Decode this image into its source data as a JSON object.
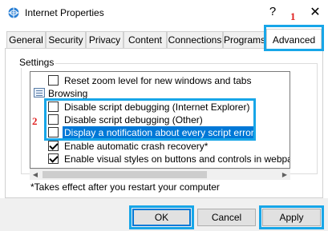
{
  "window": {
    "title": "Internet Properties",
    "help_glyph": "?",
    "close_glyph": "✕"
  },
  "annotations": [
    "1",
    "2"
  ],
  "tabs": [
    {
      "label": "General"
    },
    {
      "label": "Security"
    },
    {
      "label": "Privacy"
    },
    {
      "label": "Content"
    },
    {
      "label": "Connections"
    },
    {
      "label": "Programs"
    },
    {
      "label": "Advanced",
      "active": true
    }
  ],
  "settings": {
    "group_label": "Settings",
    "items": [
      {
        "type": "checkbox",
        "checked": false,
        "label": "Reset zoom level for new windows and tabs"
      },
      {
        "type": "category",
        "label": "Browsing",
        "icon": "folder-icon"
      },
      {
        "type": "checkbox",
        "checked": false,
        "label": "Disable script debugging (Internet Explorer)"
      },
      {
        "type": "checkbox",
        "checked": false,
        "label": "Disable script debugging (Other)"
      },
      {
        "type": "checkbox",
        "checked": false,
        "label": "Display a notification about every script error",
        "selected": true
      },
      {
        "type": "checkbox",
        "checked": true,
        "label": "Enable automatic crash recovery*"
      },
      {
        "type": "checkbox",
        "checked": true,
        "label": "Enable visual styles on buttons and controls in webpages"
      }
    ],
    "scroll_left": "◀",
    "scroll_right": "▶"
  },
  "note": "*Takes effect after you restart your computer",
  "buttons": {
    "ok": "OK",
    "cancel": "Cancel",
    "apply": "Apply"
  },
  "colors": {
    "highlight": "#0078d7",
    "annotation_outline": "#17a6e8",
    "annotation_number": "#e0201f"
  }
}
